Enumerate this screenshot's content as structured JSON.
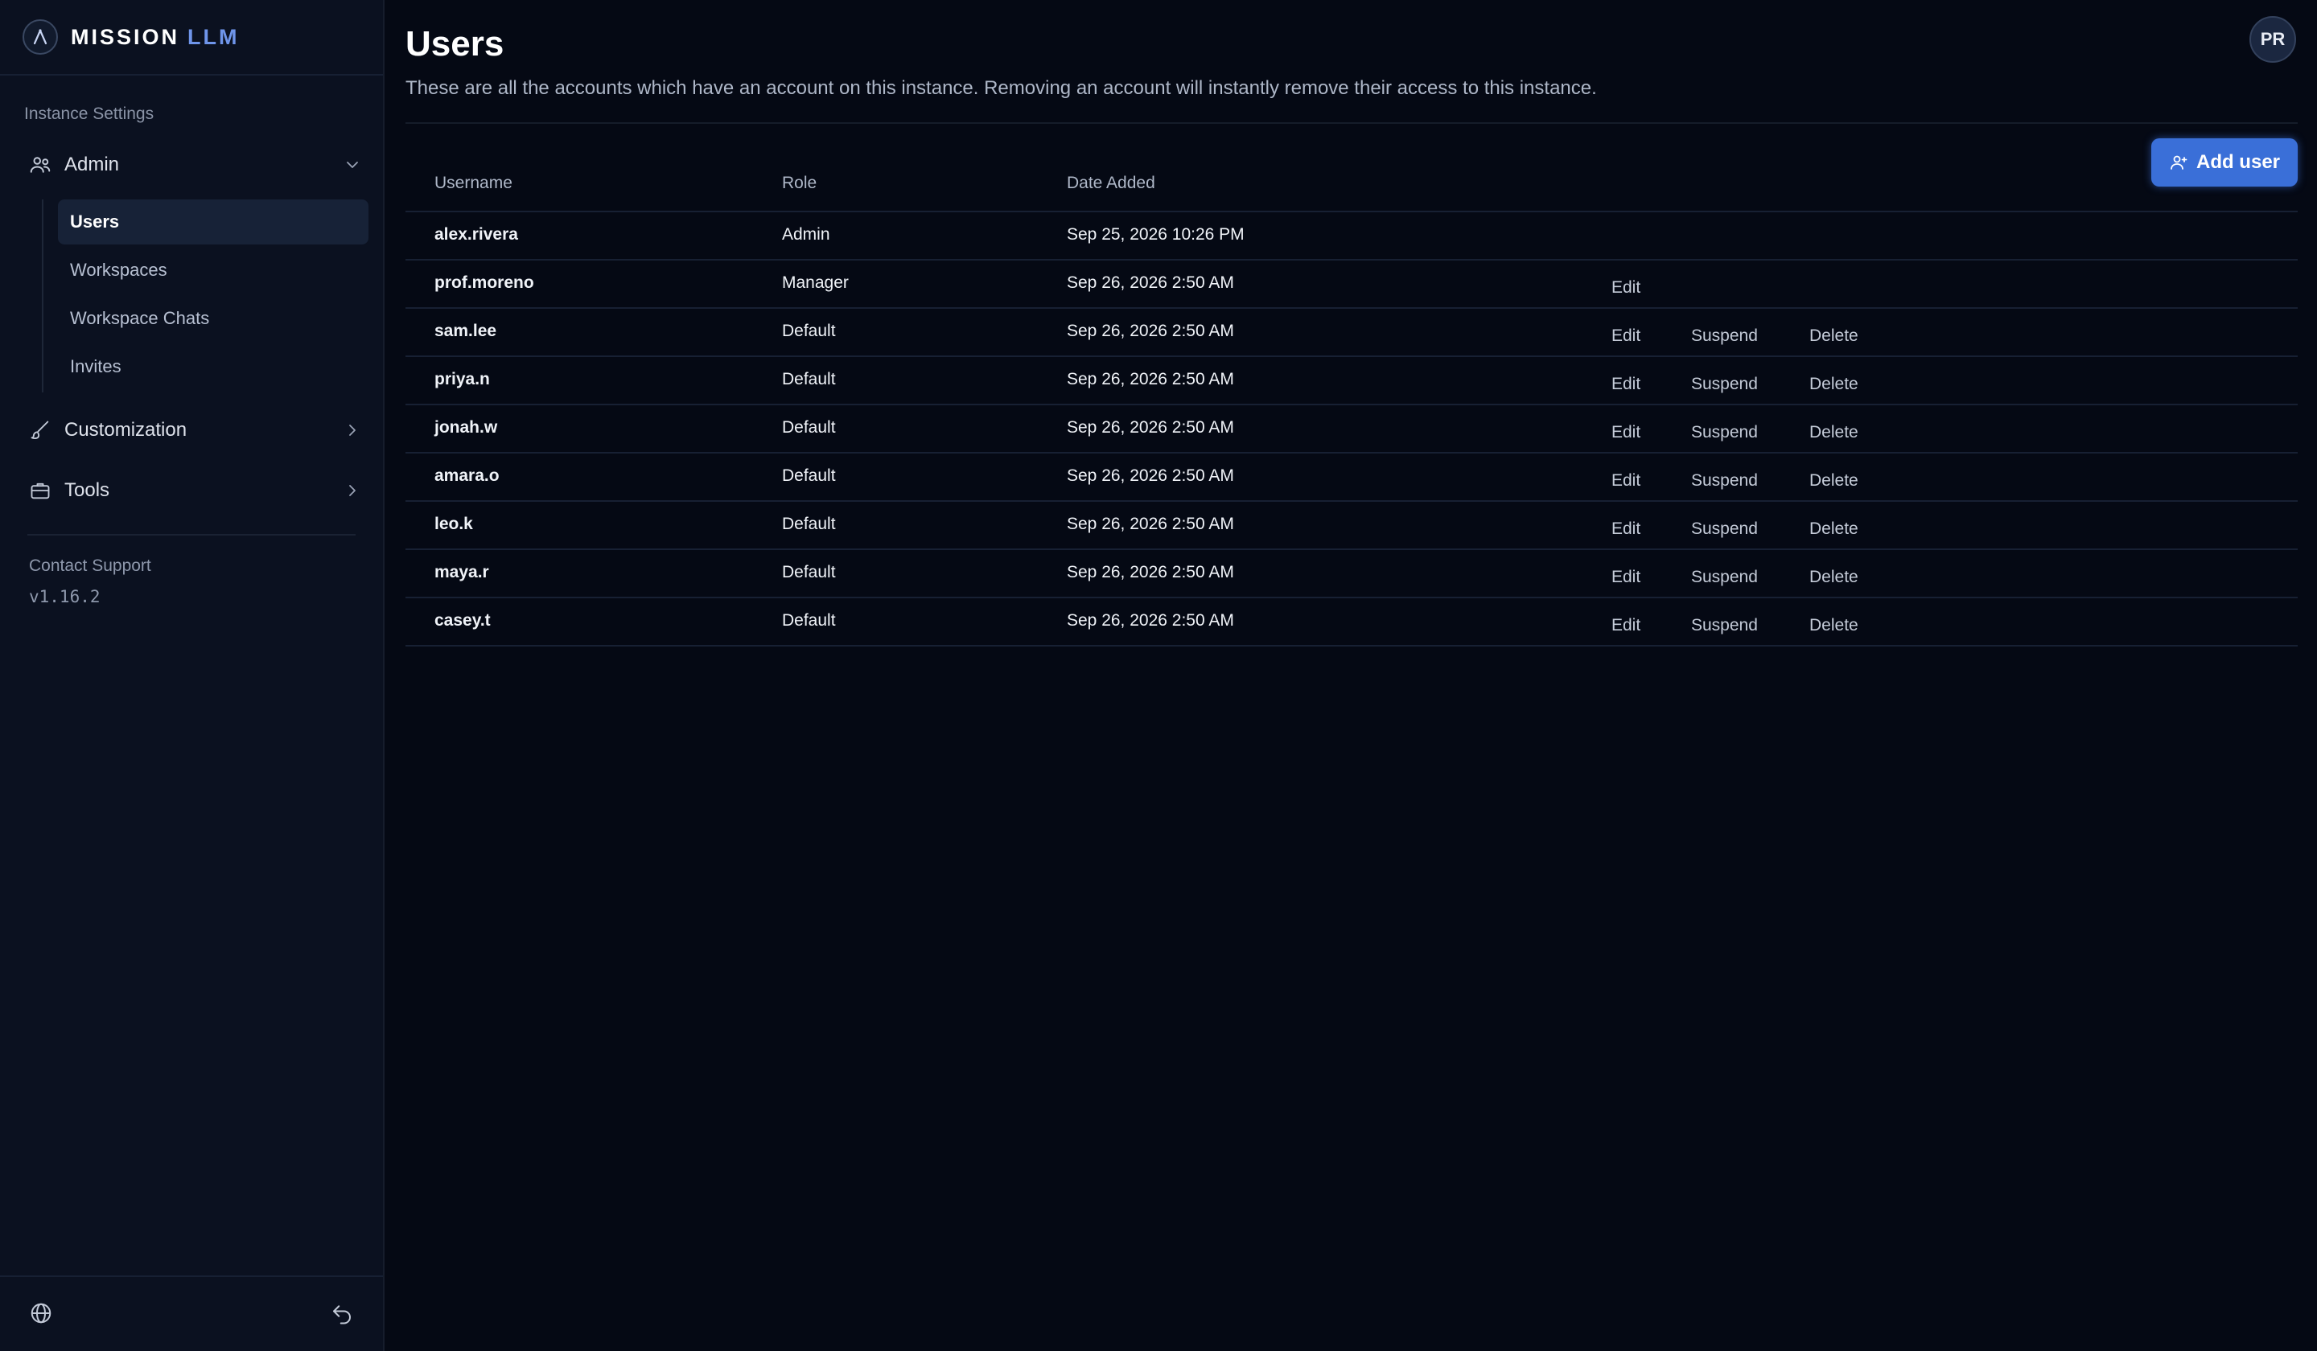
{
  "brand": {
    "name_primary": "MISSION",
    "name_accent": "LLM"
  },
  "sidebar": {
    "section_label": "Instance Settings",
    "groups": [
      {
        "label": "Admin",
        "icon": "users-icon",
        "expanded": true
      },
      {
        "label": "Customization",
        "icon": "brush-icon",
        "expanded": false
      },
      {
        "label": "Tools",
        "icon": "briefcase-icon",
        "expanded": false
      }
    ],
    "admin_items": [
      {
        "label": "Users",
        "active": true
      },
      {
        "label": "Workspaces",
        "active": false
      },
      {
        "label": "Workspace Chats",
        "active": false
      },
      {
        "label": "Invites",
        "active": false
      }
    ],
    "support_label": "Contact Support",
    "version": "v1.16.2"
  },
  "header": {
    "title": "Users",
    "description": "These are all the accounts which have an account on this instance. Removing an account will instantly remove their access to this instance.",
    "avatar_initials": "PR",
    "add_user_label": "Add user"
  },
  "table": {
    "columns": [
      "Username",
      "Role",
      "Date Added"
    ],
    "actions": {
      "edit": "Edit",
      "suspend": "Suspend",
      "delete": "Delete"
    },
    "rows": [
      {
        "username": "alex.rivera",
        "role": "Admin",
        "date": "Sep 25, 2026 10:26 PM",
        "actions": []
      },
      {
        "username": "prof.moreno",
        "role": "Manager",
        "date": "Sep 26, 2026 2:50 AM",
        "actions": [
          "edit"
        ]
      },
      {
        "username": "sam.lee",
        "role": "Default",
        "date": "Sep 26, 2026 2:50 AM",
        "actions": [
          "edit",
          "suspend",
          "delete"
        ]
      },
      {
        "username": "priya.n",
        "role": "Default",
        "date": "Sep 26, 2026 2:50 AM",
        "actions": [
          "edit",
          "suspend",
          "delete"
        ]
      },
      {
        "username": "jonah.w",
        "role": "Default",
        "date": "Sep 26, 2026 2:50 AM",
        "actions": [
          "edit",
          "suspend",
          "delete"
        ]
      },
      {
        "username": "amara.o",
        "role": "Default",
        "date": "Sep 26, 2026 2:50 AM",
        "actions": [
          "edit",
          "suspend",
          "delete"
        ]
      },
      {
        "username": "leo.k",
        "role": "Default",
        "date": "Sep 26, 2026 2:50 AM",
        "actions": [
          "edit",
          "suspend",
          "delete"
        ]
      },
      {
        "username": "maya.r",
        "role": "Default",
        "date": "Sep 26, 2026 2:50 AM",
        "actions": [
          "edit",
          "suspend",
          "delete"
        ]
      },
      {
        "username": "casey.t",
        "role": "Default",
        "date": "Sep 26, 2026 2:50 AM",
        "actions": [
          "edit",
          "suspend",
          "delete"
        ]
      }
    ]
  },
  "colors": {
    "background": "#050914",
    "sidebar": "#0b1120",
    "accent": "#3a6fd8",
    "brand_accent": "#6f95ea"
  }
}
